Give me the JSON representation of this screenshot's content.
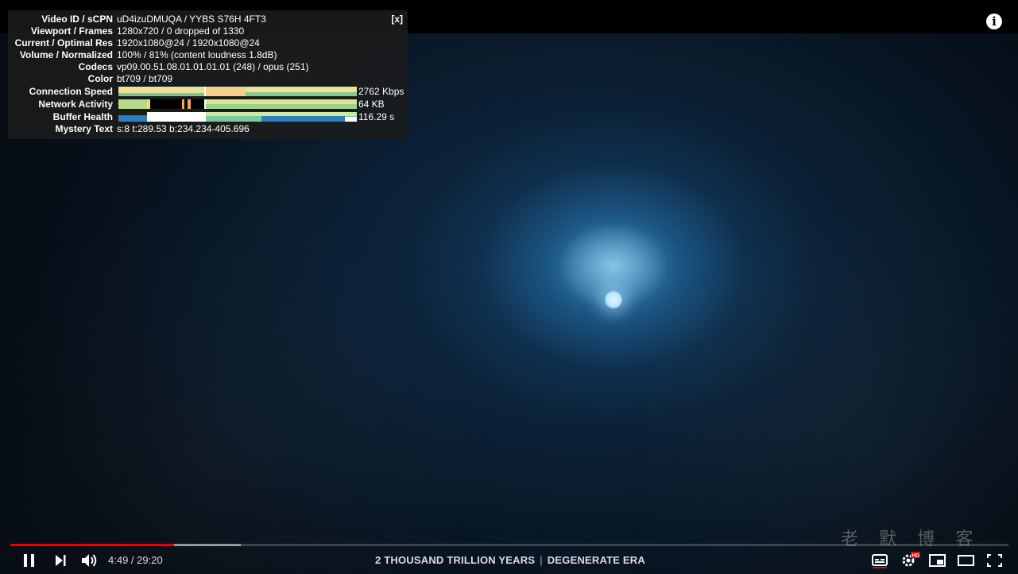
{
  "stats": {
    "close_label": "[x]",
    "rows": [
      {
        "key": "Video ID / sCPN",
        "value": "uD4izuDMUQA / YYBS S76H 4FT3"
      },
      {
        "key": "Viewport / Frames",
        "value": "1280x720 / 0 dropped of 1330"
      },
      {
        "key": "Current / Optimal Res",
        "value": "1920x1080@24 / 1920x1080@24"
      },
      {
        "key": "Volume / Normalized",
        "value": "100% / 81% (content loudness 1.8dB)"
      },
      {
        "key": "Codecs",
        "value": "vp09.00.51.08.01.01.01.01 (248) / opus (251)"
      },
      {
        "key": "Color",
        "value": "bt709 / bt709"
      }
    ],
    "graphs": [
      {
        "key": "Connection Speed",
        "value": "2762 Kbps"
      },
      {
        "key": "Network Activity",
        "value": "64 KB"
      },
      {
        "key": "Buffer Health",
        "value": "116.29 s"
      }
    ],
    "mystery": {
      "key": "Mystery Text",
      "value": "s:8 t:289.53 b:234.234-405.696"
    }
  },
  "player": {
    "current_time": "4:49",
    "duration": "29:20",
    "time_sep": " / ",
    "chapter_left": "2 THOUSAND TRILLION YEARS",
    "chapter_sep": "|",
    "chapter_right": "DEGENERATE ERA",
    "progress_played": 0.164,
    "progress_buffered": 0.231,
    "quality_badge": "HD",
    "accent": "#ee0000"
  },
  "watermark": {
    "text": "老 默 博 客"
  }
}
